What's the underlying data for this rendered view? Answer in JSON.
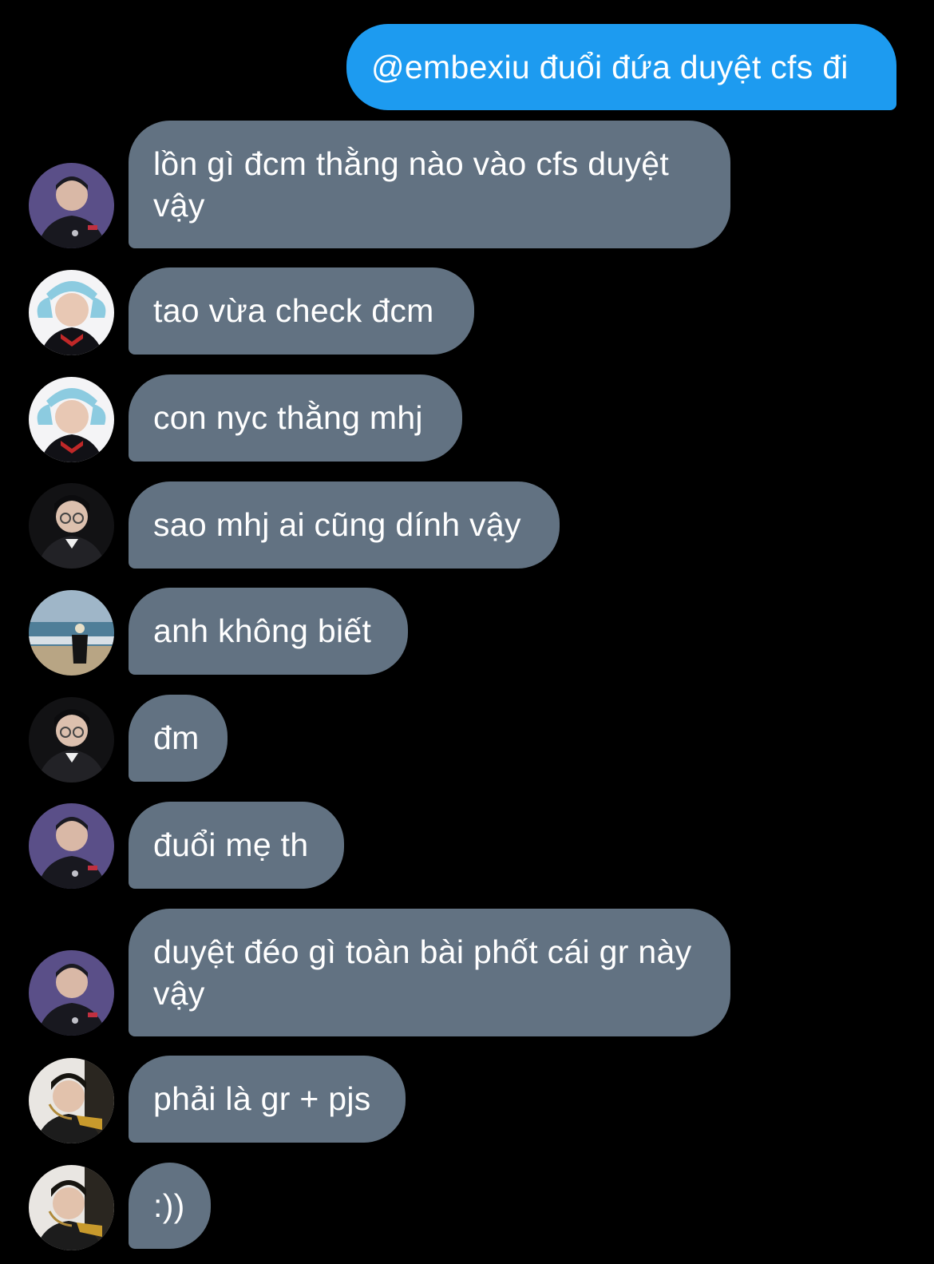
{
  "conversation": {
    "outgoing": [
      {
        "text": "@embexiu đuổi đứa duyệt cfs đi"
      }
    ],
    "incoming": [
      {
        "text": "lồn gì đcm thằng nào vào cfs duyệt vậy",
        "avatar": "avatar-purple-jersey"
      },
      {
        "text": "tao vừa check đcm",
        "avatar": "avatar-blue-hat"
      },
      {
        "text": "con nyc thằng mhj",
        "avatar": "avatar-blue-hat"
      },
      {
        "text": "sao mhj ai cũng dính vậy",
        "avatar": "avatar-glasses-dark"
      },
      {
        "text": "anh không biết",
        "avatar": "avatar-beach"
      },
      {
        "text": "đm",
        "avatar": "avatar-glasses-dark"
      },
      {
        "text": "đuổi mẹ th",
        "avatar": "avatar-purple-jersey"
      },
      {
        "text": "duyệt đéo gì toàn bài phốt cái gr này vậy",
        "avatar": "avatar-purple-jersey"
      },
      {
        "text": "phải là gr + pjs",
        "avatar": "avatar-headset"
      },
      {
        "text": ":))",
        "avatar": "avatar-headset"
      }
    ]
  },
  "colors": {
    "background": "#000000",
    "outgoing_bubble": "#1d9bf0",
    "incoming_bubble": "#627282",
    "text": "#ffffff"
  }
}
